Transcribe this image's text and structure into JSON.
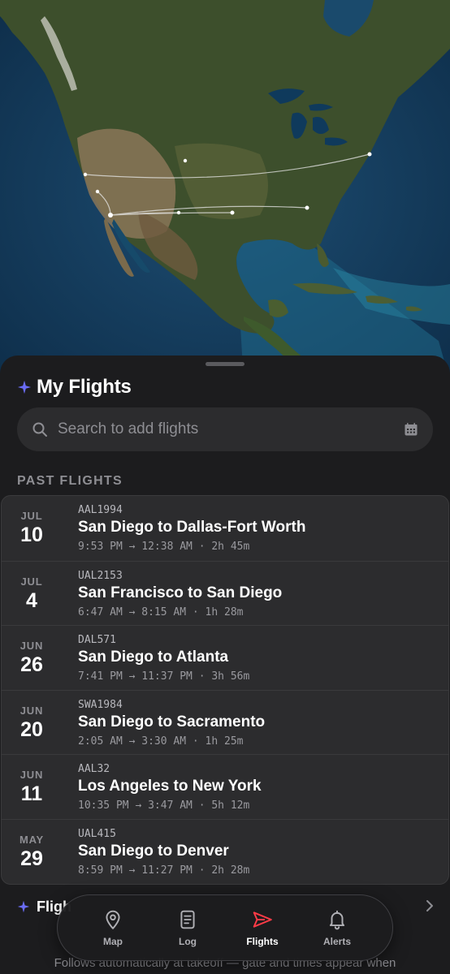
{
  "sheet": {
    "title": "My Flights",
    "search_placeholder": "Search to add flights",
    "section_label": "PAST FLIGHTS",
    "flights": [
      {
        "month": "JUL",
        "day": "10",
        "code": "AAL1994",
        "route": "San Diego to Dallas-Fort Worth",
        "times": "9:53 PM → 12:38 AM · 2h 45m"
      },
      {
        "month": "JUL",
        "day": "4",
        "code": "UAL2153",
        "route": "San Francisco to San Diego",
        "times": "6:47 AM → 8:15 AM · 1h 28m"
      },
      {
        "month": "JUN",
        "day": "26",
        "code": "DAL571",
        "route": "San Diego to Atlanta",
        "times": "7:41 PM → 11:37 PM · 3h 56m"
      },
      {
        "month": "JUN",
        "day": "20",
        "code": "SWA1984",
        "route": "San Diego to Sacramento",
        "times": "2:05 AM → 3:30 AM · 1h 25m"
      },
      {
        "month": "JUN",
        "day": "11",
        "code": "AAL32",
        "route": "Los Angeles to New York",
        "times": "10:35 PM → 3:47 AM · 5h 12m"
      },
      {
        "month": "MAY",
        "day": "29",
        "code": "UAL415",
        "route": "San Diego to Denver",
        "times": "8:59 PM → 11:27 PM · 2h 28m"
      }
    ],
    "footer_label": "Fligh",
    "footnote": "Follows automatically at takeoff — gate and times appear when"
  },
  "tabbar": {
    "tabs": [
      {
        "label": "Map",
        "icon": "map-pin-icon",
        "active": false
      },
      {
        "label": "Log",
        "icon": "document-icon",
        "active": false
      },
      {
        "label": "Flights",
        "icon": "paper-plane-icon",
        "active": true
      },
      {
        "label": "Alerts",
        "icon": "bell-icon",
        "active": false
      }
    ]
  },
  "colors": {
    "background": "#1c1c1e",
    "card": "#2c2c2e",
    "accent_sparkle": "#6a6cf6",
    "accent_active": "#ff3b47",
    "muted_text": "#8e8e93"
  }
}
